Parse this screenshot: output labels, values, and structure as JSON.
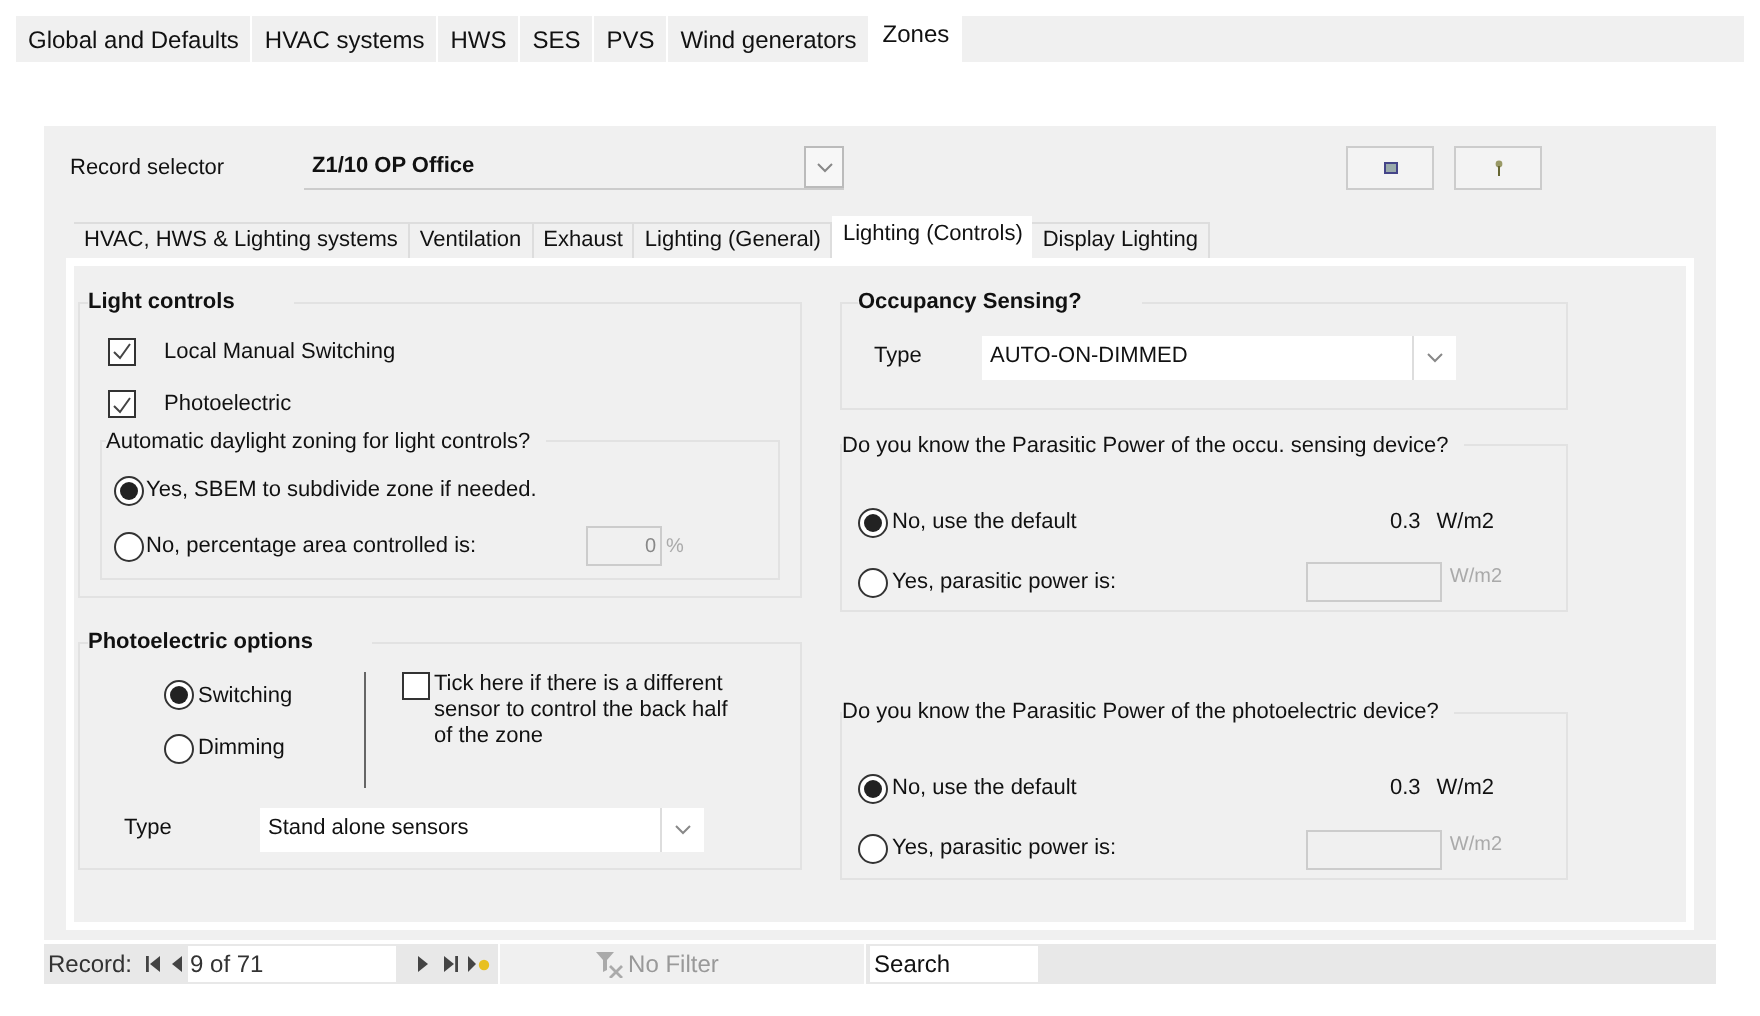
{
  "top_tabs": [
    {
      "label": "Global and Defaults",
      "selected": false
    },
    {
      "label": "HVAC systems",
      "selected": false
    },
    {
      "label": "HWS",
      "selected": false
    },
    {
      "label": "SES",
      "selected": false
    },
    {
      "label": "PVS",
      "selected": false
    },
    {
      "label": "Wind generators",
      "selected": false
    },
    {
      "label": "Zones",
      "selected": true
    }
  ],
  "record_selector": {
    "label": "Record selector",
    "value": "Z1/10 OP Office"
  },
  "sub_tabs": [
    {
      "label": "HVAC, HWS & Lighting systems",
      "selected": false
    },
    {
      "label": "Ventilation",
      "selected": false
    },
    {
      "label": "Exhaust",
      "selected": false
    },
    {
      "label": "Lighting (General)",
      "selected": false
    },
    {
      "label": "Lighting (Controls)",
      "selected": true
    },
    {
      "label": "Display Lighting",
      "selected": false
    }
  ],
  "light_controls": {
    "title": "Light controls",
    "checkboxes": [
      {
        "label": "Local Manual Switching",
        "checked": true
      },
      {
        "label": "Photoelectric",
        "checked": true
      }
    ],
    "daylight_zoning": {
      "title": "Automatic daylight zoning for light controls?",
      "options": [
        {
          "label": "Yes, SBEM to subdivide zone if needed.",
          "selected": true
        },
        {
          "label": "No, percentage area controlled is:",
          "selected": false
        }
      ],
      "percentage": "0",
      "unit": "%"
    }
  },
  "photoelectric_options": {
    "title": "Photoelectric options",
    "modes": [
      {
        "label": "Switching",
        "selected": true
      },
      {
        "label": "Dimming",
        "selected": false
      }
    ],
    "back_half_sensor": {
      "label": "Tick here if there is a different sensor to control the back half of the zone",
      "checked": false
    },
    "type": {
      "label": "Type",
      "value": "Stand alone sensors"
    }
  },
  "occupancy_sensing": {
    "title": "Occupancy Sensing?",
    "type": {
      "label": "Type",
      "value": "AUTO-ON-DIMMED"
    }
  },
  "occupancy_parasitic": {
    "title": "Do you know the Parasitic Power of the occu. sensing device?",
    "options": [
      {
        "label": "No, use the default",
        "selected": true
      },
      {
        "label": "Yes, parasitic power is:",
        "selected": false
      }
    ],
    "default_value": "0.3",
    "default_unit": "W/m2",
    "custom_unit": "W/m2"
  },
  "photoelectric_parasitic": {
    "title": "Do you know the Parasitic Power of the photoelectric device?",
    "options": [
      {
        "label": "No, use the default",
        "selected": true
      },
      {
        "label": "Yes, parasitic power is:",
        "selected": false
      }
    ],
    "default_value": "0.3",
    "default_unit": "W/m2",
    "custom_unit": "W/m2"
  },
  "record_nav": {
    "label": "Record:",
    "position": "9 of 71",
    "filter": "No Filter",
    "search": "Search"
  }
}
